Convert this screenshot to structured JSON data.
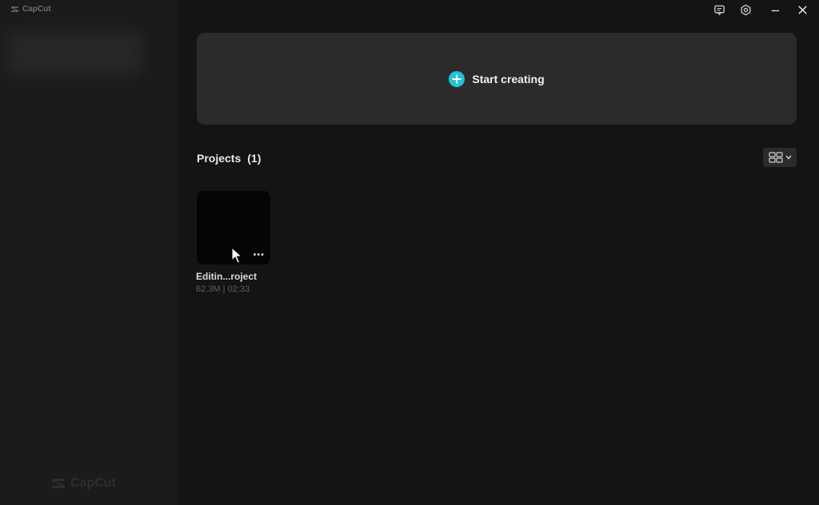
{
  "app": {
    "name": "CapCut",
    "logo_icon": "capcut-logo-icon"
  },
  "window_controls": {
    "feedback_icon": "feedback-icon",
    "settings_icon": "settings-icon",
    "minimize_icon": "minimize-icon",
    "close_icon": "close-icon"
  },
  "start": {
    "label": "Start creating",
    "icon": "plus-circle-icon",
    "icon_color": "#22c3d6"
  },
  "projects": {
    "title": "Projects",
    "count": "(1)",
    "view_toggle_icon": "grid-view-icon",
    "items": [
      {
        "name": "Editin...roject",
        "size": "62.3M",
        "separator": "|",
        "duration": "02:33",
        "more_icon": "more-icon"
      }
    ]
  }
}
